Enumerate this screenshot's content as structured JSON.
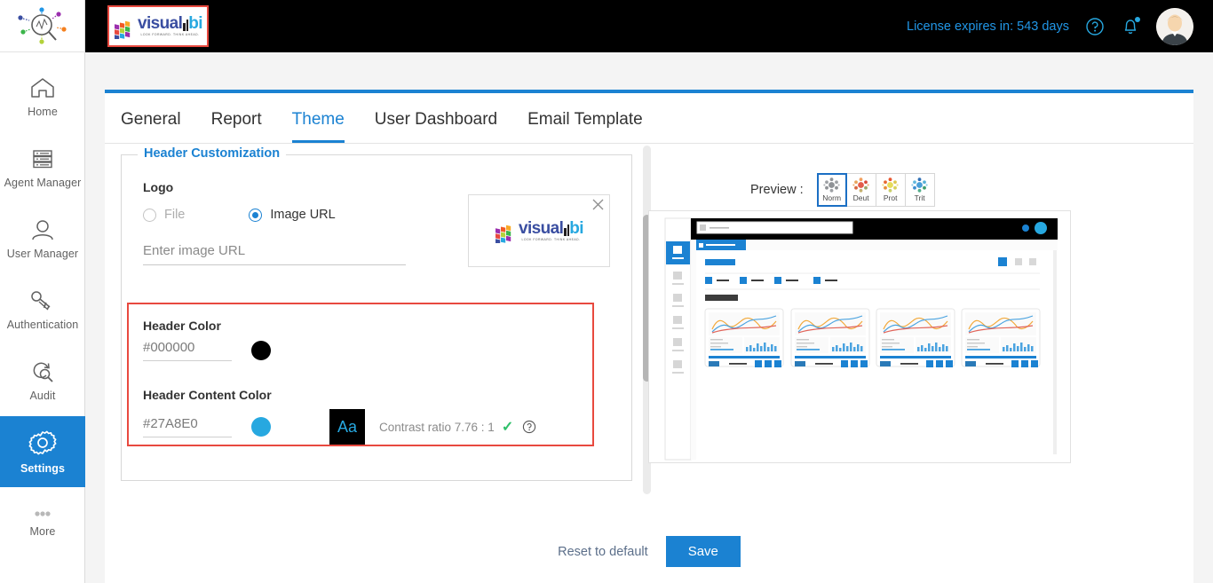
{
  "rail": {
    "logo_icon": "analytics-magnifier-logo",
    "items": [
      {
        "label": "Home",
        "icon": "home-icon",
        "active": false
      },
      {
        "label": "Agent Manager",
        "icon": "server-list-icon",
        "active": false
      },
      {
        "label": "User Manager",
        "icon": "user-icon",
        "active": false
      },
      {
        "label": "Authentication",
        "icon": "keys-icon",
        "active": false
      },
      {
        "label": "Audit",
        "icon": "audit-search-icon",
        "active": false
      },
      {
        "label": "Settings",
        "icon": "gear-icon",
        "active": true
      },
      {
        "label": "More",
        "icon": "ellipsis-icon",
        "active": false
      }
    ]
  },
  "header": {
    "brand_name_1": "visual",
    "brand_name_2": "bi",
    "brand_tagline": "LOOK FORWARD. THINK AHEAD.",
    "license_text": "License expires in: 543 days",
    "help_icon": "question-circle-icon",
    "notification_icon": "bell-icon",
    "avatar": "user-avatar",
    "background_color": "#000000",
    "content_color": "#27A8E0"
  },
  "tabs": [
    {
      "label": "General",
      "active": false
    },
    {
      "label": "Report",
      "active": false
    },
    {
      "label": "Theme",
      "active": true
    },
    {
      "label": "User Dashboard",
      "active": false
    },
    {
      "label": "Email Template",
      "active": false
    }
  ],
  "form": {
    "legend": "Header Customization",
    "logo_label": "Logo",
    "radio_file": "File",
    "radio_url": "Image URL",
    "selected_radio": "Image URL",
    "url_placeholder": "Enter image URL",
    "url_value": "",
    "logo_preview_alt": "visualbi",
    "close_icon": "close-icon",
    "header_color_label": "Header Color",
    "header_color_value": "#000000",
    "header_color_swatch": "#000000",
    "header_content_color_label": "Header Content Color",
    "header_content_color_value": "#27A8E0",
    "header_content_color_swatch": "#27A8E0",
    "aa_sample": "Aa",
    "contrast_text": "Contrast ratio 7.76 : 1",
    "contrast_check": "✓",
    "contrast_help_icon": "question-circle-icon",
    "highlight_color": "#E8493F"
  },
  "preview": {
    "label": "Preview :",
    "modes": [
      {
        "label": "Norm",
        "active": true
      },
      {
        "label": "Deut",
        "active": false
      },
      {
        "label": "Prot",
        "active": false
      },
      {
        "label": "Trit",
        "active": false
      }
    ],
    "mock_name": "dashboard-preview-mock"
  },
  "footer": {
    "reset_label": "Reset to default",
    "save_label": "Save",
    "save_color": "#1B82D2"
  }
}
